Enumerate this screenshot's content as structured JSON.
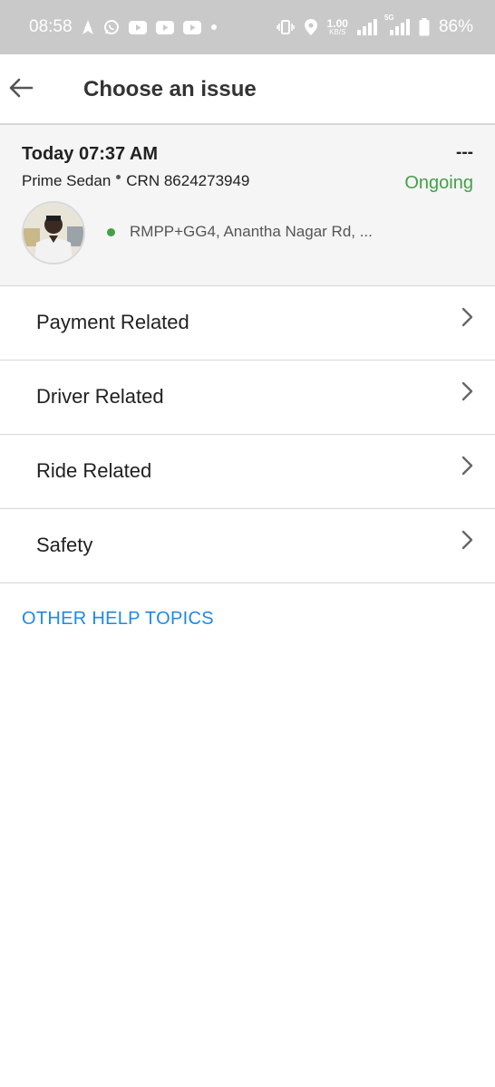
{
  "status_bar": {
    "time": "08:58",
    "net_speed_value": "1.00",
    "net_speed_unit": "KB/S",
    "network_type": "5G",
    "battery": "86%",
    "left_icons": [
      "navigation-arrow-icon",
      "whatsapp-icon",
      "youtube-icon",
      "youtube-icon",
      "youtube-icon",
      "dot-icon"
    ],
    "right_icons": [
      "vibrate-icon",
      "location-icon",
      "signal-icon",
      "signal-5g-icon",
      "battery-icon"
    ]
  },
  "header": {
    "title": "Choose an issue",
    "back_icon": "back-arrow-icon"
  },
  "ride": {
    "date_time": "Today 07:37 AM",
    "vehicle": "Prime Sedan",
    "crn": "CRN 8624273949",
    "fare": "---",
    "status": "Ongoing",
    "pickup": "RMPP+GG4, Anantha Nagar Rd, ...",
    "status_color": "#43a047"
  },
  "issues": [
    {
      "label": "Payment Related"
    },
    {
      "label": "Driver Related"
    },
    {
      "label": "Ride Related"
    },
    {
      "label": "Safety"
    }
  ],
  "help_link": "OTHER HELP TOPICS",
  "colors": {
    "accent_link": "#1e88e5",
    "status_bar_bg": "#c9c9c9",
    "card_bg": "#f5f5f5"
  }
}
